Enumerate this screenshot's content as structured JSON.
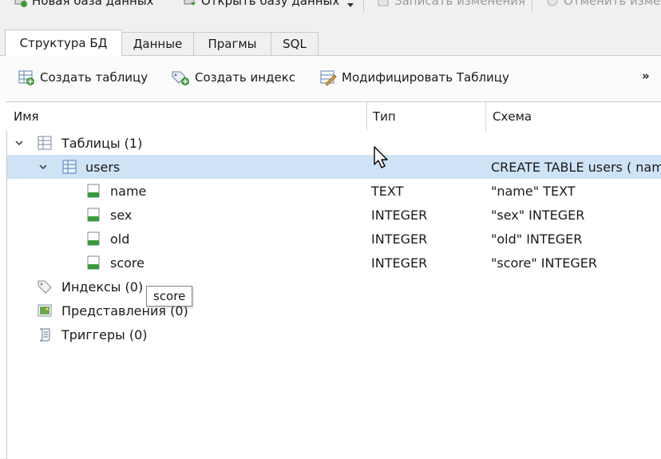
{
  "toolbar": {
    "new_db": "Новая база данных",
    "open_db": "Открыть базу данных",
    "write_changes": "Записать изменения",
    "revert_changes": "Отменить изме"
  },
  "tabs": [
    {
      "label": "Структура БД",
      "active": true
    },
    {
      "label": "Данные",
      "active": false
    },
    {
      "label": "Прагмы",
      "active": false
    },
    {
      "label": "SQL",
      "active": false
    }
  ],
  "actions": {
    "create_table": "Создать таблицу",
    "create_index": "Создать индекс",
    "modify_table": "Модифицировать Таблицу",
    "more": "»"
  },
  "tree": {
    "headers": {
      "name": "Имя",
      "type": "Тип",
      "schema": "Схема"
    },
    "tables_group": "Таблицы (1)",
    "table": {
      "name": "users",
      "schema": "CREATE TABLE users ( nam"
    },
    "fields": [
      {
        "name": "name",
        "type": "TEXT",
        "schema": "\"name\" TEXT"
      },
      {
        "name": "sex",
        "type": "INTEGER",
        "schema": "\"sex\" INTEGER"
      },
      {
        "name": "old",
        "type": "INTEGER",
        "schema": "\"old\" INTEGER"
      },
      {
        "name": "score",
        "type": "INTEGER",
        "schema": "\"score\" INTEGER"
      }
    ],
    "indexes_group": "Индексы (0)",
    "views_group": "Представления (0)",
    "triggers_group": "Триггеры (0)"
  },
  "tooltip": "score",
  "colors": {
    "selection": "#cfe3f6",
    "border": "#c9c9c9",
    "accent_green": "#3a9a3a"
  }
}
